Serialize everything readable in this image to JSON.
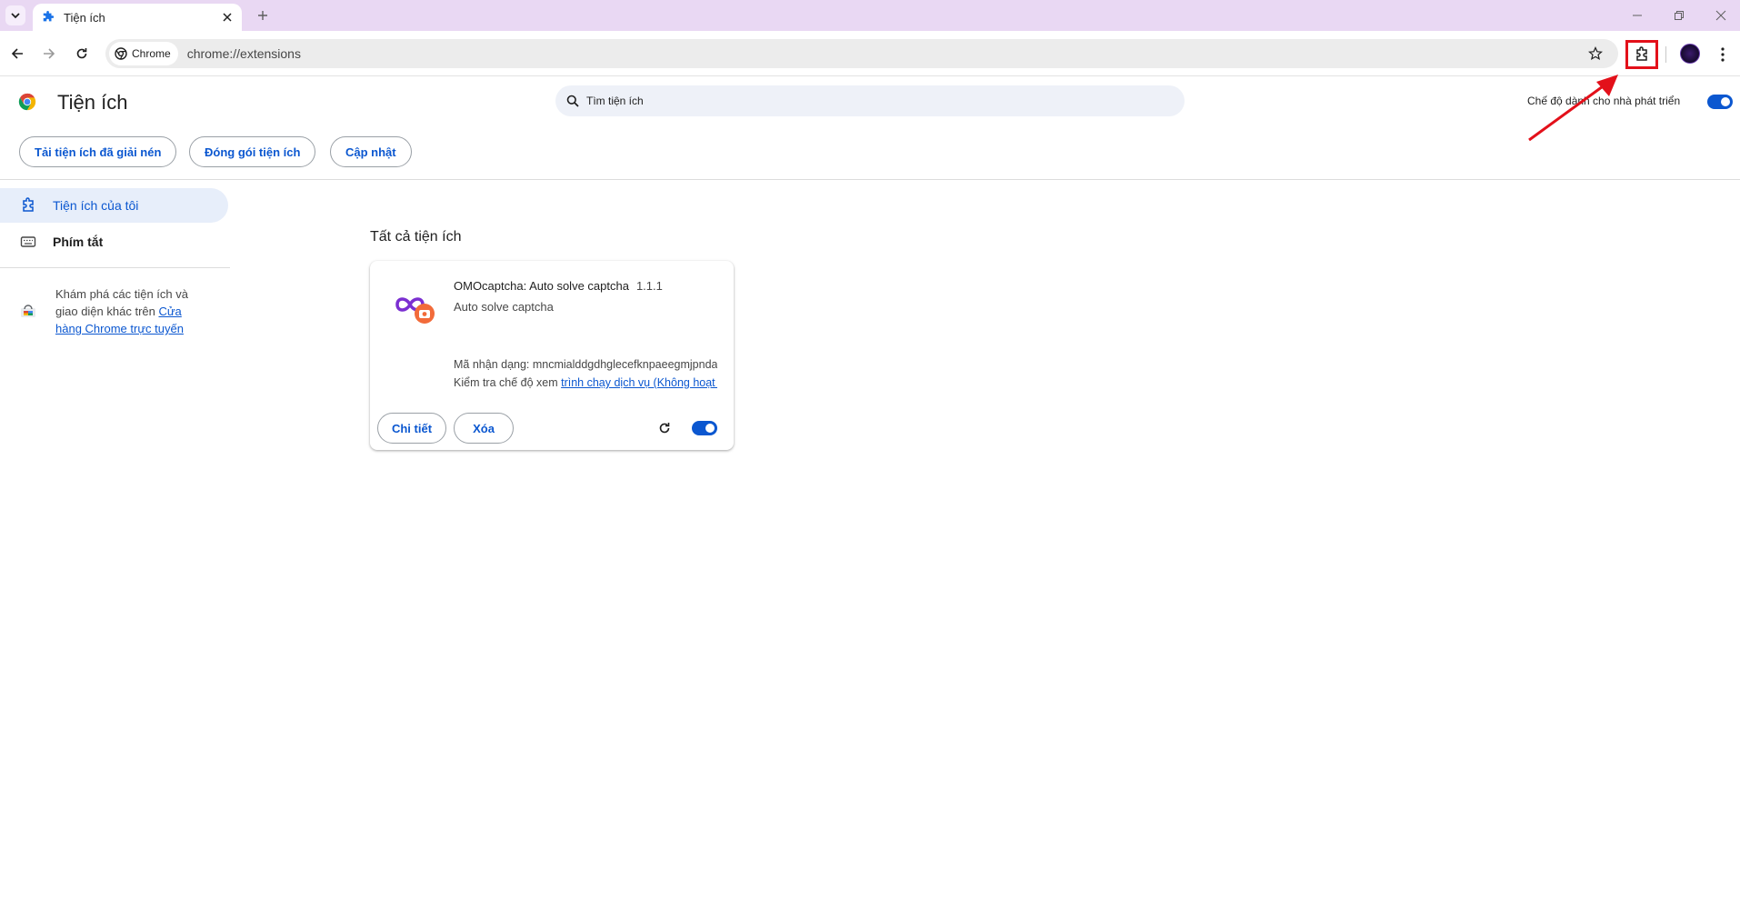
{
  "browser": {
    "tab_title": "Tiện ích",
    "chip_label": "Chrome",
    "url": "chrome://extensions",
    "colors": {
      "tabstrip": "#e9d8f3",
      "accent": "#0b57d0",
      "highlight_box": "#e3101a"
    }
  },
  "page": {
    "title": "Tiện ích",
    "search_placeholder": "Tìm tiện ích",
    "dev_mode_label": "Chế độ dành cho nhà phát triển",
    "dev_mode_on": true,
    "buttons": {
      "load_unpacked": "Tải tiện ích đã giải nén",
      "pack": "Đóng gói tiện ích",
      "update": "Cập nhật"
    }
  },
  "sidebar": {
    "items": [
      {
        "label": "Tiện ích của tôi",
        "icon": "puzzle-icon",
        "active": true
      },
      {
        "label": "Phím tắt",
        "icon": "keyboard-icon",
        "active": false
      }
    ],
    "explore_text": "Khám phá các tiện ích và giao diện khác trên ",
    "explore_link": "Cửa hàng Chrome trực tuyến"
  },
  "main": {
    "section_title": "Tất cả tiện ích",
    "extension": {
      "name": "OMOcaptcha: Auto solve captcha",
      "version": "1.1.1",
      "description": "Auto solve captcha",
      "id_line": "Mã nhận dạng: mncmialddgdhglecefknpaeegmjpndag",
      "inspect_prefix": "Kiểm tra chế độ xem ",
      "inspect_link": "trình chạy dịch vụ (Không hoạt động)",
      "details_button": "Chi tiết",
      "remove_button": "Xóa",
      "enabled": true
    }
  }
}
